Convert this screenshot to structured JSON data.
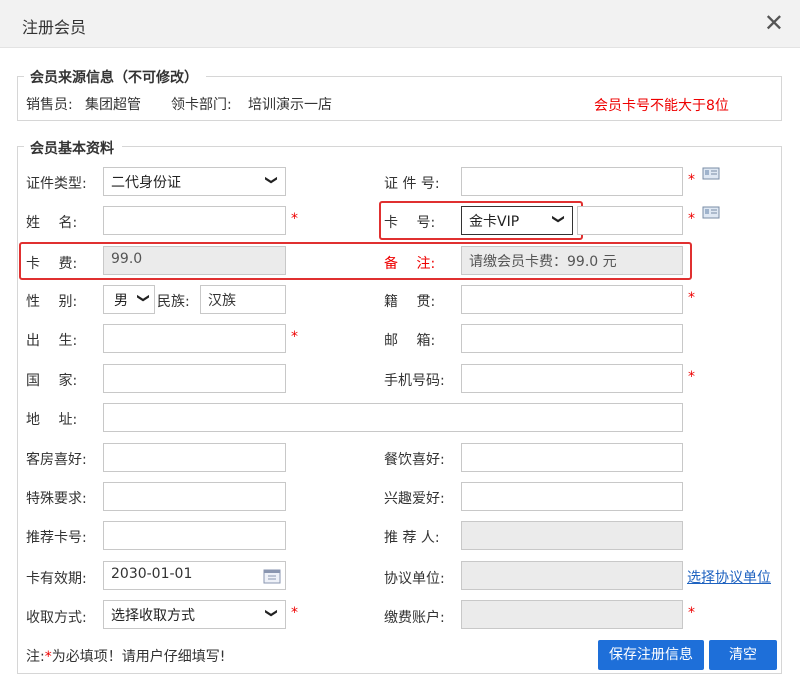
{
  "dialog": {
    "title": "注册会员"
  },
  "source": {
    "legend": "会员来源信息（不可修改）",
    "salesperson_label": "销售员:",
    "salesperson_value": "集团超管",
    "dept_label": "领卡部门:",
    "dept_value": "培训演示一店",
    "warning": "会员卡号不能大于8位"
  },
  "basic": {
    "legend": "会员基本资料",
    "id_type_label": "证件类型:",
    "id_type_value": "二代身份证",
    "id_no_label": "证 件 号:",
    "name_label": "姓　 名:",
    "card_label": "卡　 号:",
    "card_type_value": "金卡VIP",
    "fee_label": "卡　 费:",
    "fee_value": "99.0",
    "remark_label": "备　 注:",
    "remark_value": "请缴会员卡费：99.0 元",
    "gender_label": "性　 别:",
    "gender_value": "男",
    "ethnicity_label": "民族:",
    "ethnicity_value": "汉族",
    "native_label": "籍　 贯:",
    "birth_label": "出　 生:",
    "email_label": "邮　 箱:",
    "country_label": "国　 家:",
    "phone_label": "手机号码:",
    "address_label": "地　 址:",
    "room_pref_label": "客房喜好:",
    "dining_pref_label": "餐饮喜好:",
    "special_label": "特殊要求:",
    "hobby_label": "兴趣爱好:",
    "ref_card_label": "推荐卡号:",
    "referrer_label": "推 荐 人:",
    "expiry_label": "卡有效期:",
    "expiry_value": "2030-01-01",
    "agreement_label": "协议单位:",
    "agreement_link": "选择协议单位",
    "collect_label": "收取方式:",
    "collect_value": "选择收取方式",
    "account_label": "缴费账户:"
  },
  "footer": {
    "note_prefix": "注:",
    "note_star": "*",
    "note_text": "为必填项！请用户仔细填写!",
    "save_label": "保存注册信息",
    "clear_label": "清空"
  },
  "star": "*",
  "icons": {
    "close": "close-icon",
    "idcard": "id-card-reader-icon",
    "calendar": "calendar-icon"
  },
  "colors": {
    "required": "#e00",
    "highlight": "#e03030",
    "button": "#1e6fd9",
    "readonly": "#ebebeb"
  }
}
